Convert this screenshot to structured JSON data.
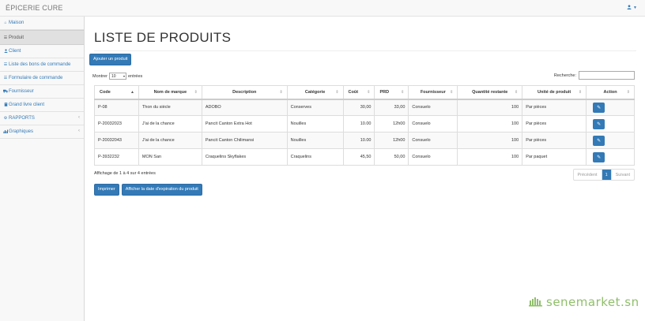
{
  "app": {
    "brand": "ÉPICERIE CURE",
    "user_icon": "user-icon"
  },
  "sidebar": {
    "items": [
      {
        "label": "Maison",
        "icon": "home-icon"
      },
      {
        "label": "Produit",
        "icon": "list-icon"
      },
      {
        "label": "Client",
        "icon": "user-icon"
      },
      {
        "label": "Liste des bons de commande",
        "icon": "list-icon"
      },
      {
        "label": "Formulaire de commande",
        "icon": "list-icon"
      },
      {
        "label": "Fournisseur",
        "icon": "truck-icon"
      },
      {
        "label": "Grand livre client",
        "icon": "book-icon"
      },
      {
        "label": "RAPPORTS",
        "icon": "gear-icon"
      },
      {
        "label": "Graphiques",
        "icon": "bar-chart-icon"
      }
    ]
  },
  "main": {
    "title": "LISTE DE PRODUITS",
    "add_button": "Ajouter un produit",
    "show_label": "Montrer",
    "show_value": "10",
    "entries_label": "entrées",
    "search_label": "Recherche:",
    "search_value": "",
    "columns": [
      "Code",
      "Nom de marque",
      "Description",
      "Catégorie",
      "Coût",
      "PRD",
      "Fournisseur",
      "Quantité restante",
      "Unité de produit",
      "Action"
    ],
    "rows": [
      {
        "code": "P-08",
        "brand": "Thon du siècle",
        "description": "ADOBO",
        "category": "Conserves",
        "cost": "30,00",
        "prd": "33,00",
        "supplier": "Consuelo",
        "qty": "100",
        "unit": "Par pièces"
      },
      {
        "code": "P-20032023",
        "brand": "J'ai de la chance",
        "description": "Pancit Canton Extra Hot",
        "category": "Nouilles",
        "cost": "10.00",
        "prd": "12h00",
        "supplier": "Consuelo",
        "qty": "100",
        "unit": "Par pièces"
      },
      {
        "code": "P-20032043",
        "brand": "J'ai de la chance",
        "description": "Pancit Canton Chilimansi",
        "category": "Nouilles",
        "cost": "10.00",
        "prd": "12h00",
        "supplier": "Consuelo",
        "qty": "100",
        "unit": "Par pièces"
      },
      {
        "code": "P-3932232",
        "brand": "MON San",
        "description": "Craquelins Skyflakes",
        "category": "Craquelins",
        "cost": "45,50",
        "prd": "50,00",
        "supplier": "Consuelo",
        "qty": "100",
        "unit": "Par paquet"
      }
    ],
    "info": "Affichage de 1 à 4 sur 4 entrées",
    "pager": {
      "prev": "Précédent",
      "current": "1",
      "next": "Suivant"
    },
    "print_button": "Imprimer",
    "expiry_button": "Afficher la date d'expiration du produit"
  },
  "watermark": {
    "text": "senemarket.sn",
    "color": "#8fbf6a"
  },
  "colors": {
    "primary": "#337ab7"
  }
}
